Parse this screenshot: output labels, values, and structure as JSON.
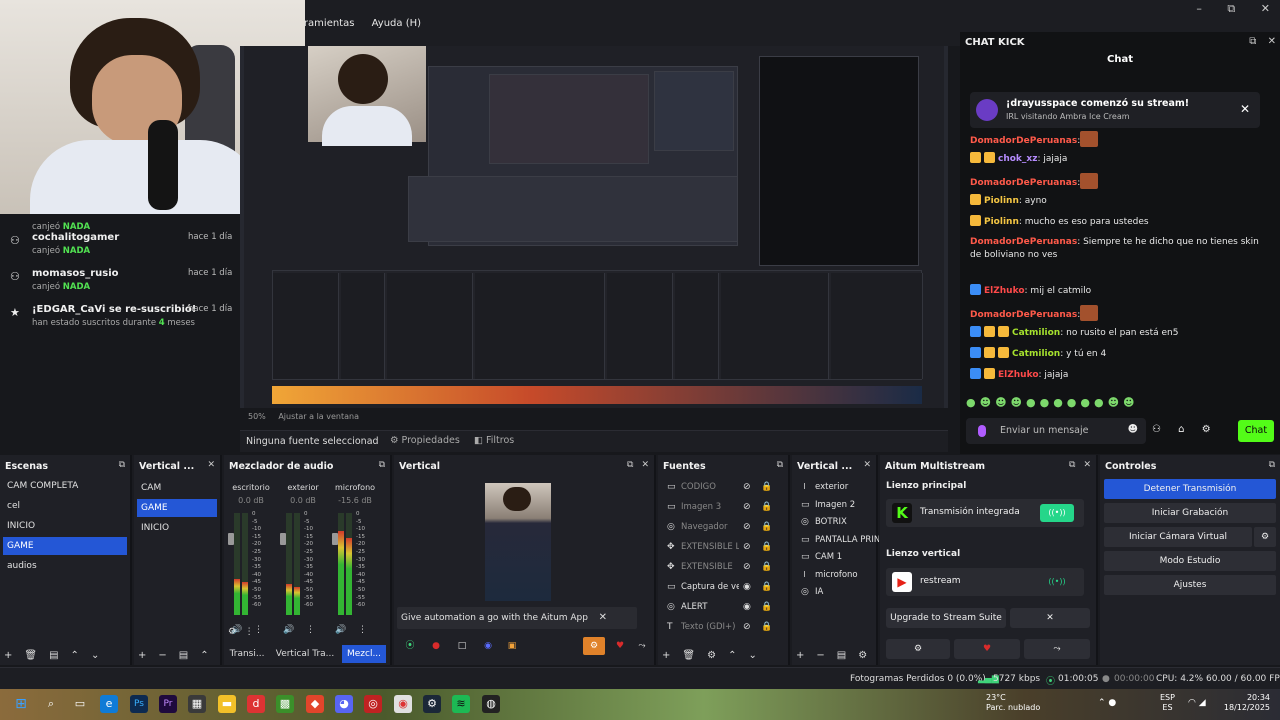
{
  "menu": {
    "items": [
      "rramientas",
      "Ayuda (H)"
    ]
  },
  "window_controls": {
    "minimize": "–",
    "maximize": "⧉",
    "close": "✕"
  },
  "activity_feed": [
    {
      "icon": "⚇",
      "name": "",
      "sub_prefix": "canjeó",
      "sub_value": "NADA",
      "time": ""
    },
    {
      "icon": "⚇",
      "name": "cochalitogamer",
      "sub_prefix": "canjeó",
      "sub_value": "NADA",
      "time": "hace 1 día"
    },
    {
      "icon": "⚇",
      "name": "momasos_rusio",
      "sub_prefix": "canjeó",
      "sub_value": "NADA",
      "time": "hace 1 día"
    },
    {
      "icon": "★",
      "name": "¡EDGAR_CaVi se re-suscribió!",
      "sub_prefix": "han estado suscritos durante",
      "sub_value": "4",
      "sub_suffix": "meses",
      "time": "hace 1 día"
    }
  ],
  "preview_meta": {
    "zoom": "50%",
    "fit": "Ajustar a la ventana"
  },
  "source_bar": {
    "no_source": "Ninguna fuente seleccionad",
    "properties": "Propiedades",
    "filters": "Filtros"
  },
  "chat": {
    "window_title": "CHAT KICK",
    "header": "Chat",
    "notice_title": "¡drayusspace comenzó su stream!",
    "notice_sub": "IRL visitando Ambra Ice Cream",
    "messages": [
      {
        "user": "DomadorDePeruanas",
        "text": ":",
        "emote": true,
        "color": "u"
      },
      {
        "user": "chok_xz",
        "text": ": jajaja",
        "emote": false,
        "color": "u2",
        "badges": [
          "#f6b93b",
          "#f6b93b"
        ]
      },
      {
        "user": "DomadorDePeruanas",
        "text": ":",
        "emote": true,
        "color": "u"
      },
      {
        "user": "Piolinn",
        "text": ": ayno",
        "emote": false,
        "color": "u4",
        "badges": [
          "#f6b93b"
        ]
      },
      {
        "user": "Piolinn",
        "text": ": mucho es eso para ustedes",
        "emote": false,
        "color": "u4",
        "badges": [
          "#f6b93b"
        ]
      },
      {
        "user": "DomadorDePeruanas",
        "text": ": Siempre te he dicho que no tienes skin de boliviano no ves",
        "emote": false,
        "color": "u"
      },
      {
        "user": "ElZhuko",
        "text": ": mij el catmilo",
        "emote": false,
        "color": "u5",
        "badges": [
          "#3b8df6"
        ]
      },
      {
        "user": "DomadorDePeruanas",
        "text": ":",
        "emote": true,
        "color": "u"
      },
      {
        "user": "Catmilion",
        "text": ": no rusito el pan está en5",
        "emote": false,
        "color": "u3",
        "badges": [
          "#3b8df6",
          "#f6b93b",
          "#f6b93b"
        ]
      },
      {
        "user": "Catmilion",
        "text": ": y tú en 4",
        "emote": false,
        "color": "u3",
        "badges": [
          "#3b8df6",
          "#f6b93b",
          "#f6b93b"
        ]
      },
      {
        "user": "ElZhuko",
        "text": ": jajaja",
        "emote": false,
        "color": "u5",
        "badges": [
          "#3b8df6",
          "#f6b93b"
        ]
      }
    ],
    "input_placeholder": "Enviar un mensaje",
    "send_button": "Chat"
  },
  "docks": {
    "scenes": {
      "title": "Escenas",
      "items": [
        "CAM COMPLETA",
        "cel",
        "INICIO",
        "GAME",
        "audios"
      ],
      "selected": "GAME"
    },
    "vertical_scenes": {
      "title": "Vertical ...",
      "items": [
        "CAM",
        "GAME",
        "INICIO"
      ],
      "selected": "GAME"
    },
    "mixer": {
      "title": "Mezclador de audio",
      "channels": [
        {
          "name": "escritorio",
          "db": "0.0 dB",
          "level": 0.35
        },
        {
          "name": "exterior",
          "db": "0.0 dB",
          "level": 0.3
        },
        {
          "name": "microfono",
          "db": "-15.6 dB",
          "level": 0.82
        }
      ],
      "tabs": [
        "Transi...",
        "Vertical Tra...",
        "Mezcl..."
      ]
    },
    "vertical": {
      "title": "Vertical",
      "automation": "Give automation a go with the Aitum App"
    },
    "sources": {
      "title": "Fuentes",
      "items": [
        {
          "name": "CODIGO",
          "dim": true,
          "icon": "▭"
        },
        {
          "name": "Imagen 3",
          "dim": true,
          "icon": "▭"
        },
        {
          "name": "Navegador",
          "dim": true,
          "icon": "◎"
        },
        {
          "name": "EXTENSIBLE LE",
          "dim": true,
          "icon": "✥"
        },
        {
          "name": "EXTENSIBLE",
          "dim": true,
          "icon": "✥"
        },
        {
          "name": "Captura de ven",
          "dim": false,
          "icon": "▭"
        },
        {
          "name": "ALERT",
          "dim": false,
          "icon": "◎"
        },
        {
          "name": "Texto (GDI+)",
          "dim": true,
          "icon": "T"
        }
      ]
    },
    "vertical_sources": {
      "title": "Vertical ...",
      "items": [
        {
          "name": "exterior",
          "icon": "⏽"
        },
        {
          "name": "Imagen 2",
          "icon": "▭"
        },
        {
          "name": "BOTRIX",
          "icon": "◎"
        },
        {
          "name": "PANTALLA PRIN",
          "icon": "▭"
        },
        {
          "name": "CAM 1",
          "icon": "▭"
        },
        {
          "name": "microfono",
          "icon": "⏽"
        },
        {
          "name": "IA",
          "icon": "◎"
        }
      ]
    },
    "aitum": {
      "title": "Aitum Multistream",
      "main_label": "Lienzo principal",
      "main_output": "Transmisión integrada",
      "vertical_label": "Lienzo vertical",
      "vertical_output": "restream",
      "upgrade": "Upgrade to Stream Suite"
    },
    "controls": {
      "title": "Controles",
      "buttons": [
        "Detener Transmisión",
        "Iniciar Grabación",
        "Iniciar Cámara Virtual",
        "Modo Estudio",
        "Ajustes"
      ]
    }
  },
  "status": {
    "dropped": "Fotogramas Perdidos 0 (0.0%)",
    "bitrate": "5727 kbps",
    "live_time": "01:00:05",
    "rec_time": "00:00:00",
    "cpu": "CPU: 4.2%",
    "fps": "60.00 / 60.00 FPS"
  },
  "taskbar": {
    "weather_temp": "23°C",
    "weather_desc": "Parc. nublado",
    "lang_top": "ESP",
    "lang_bottom": "ES",
    "time": "20:34",
    "date": "18/12/2025"
  },
  "colors": {
    "accent_blue": "#2457d6",
    "kick_green": "#53fc18",
    "bg_dark": "#1f2026"
  }
}
